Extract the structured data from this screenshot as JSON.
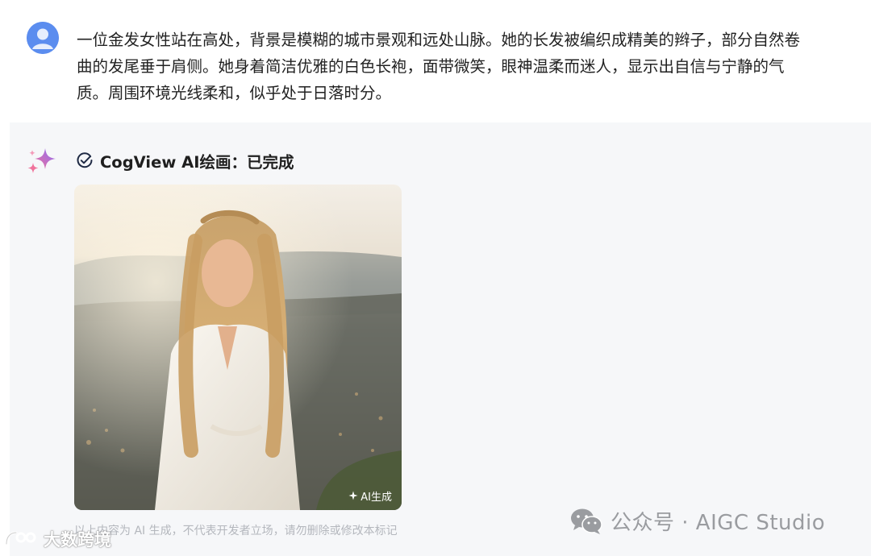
{
  "user_message": {
    "text": "一位金发女性站在高处，背景是模糊的城市景观和远处山脉。她的长发被编织成精美的辫子，部分自然卷曲的发尾垂于肩侧。她身着简洁优雅的白色长袍，面带微笑，眼神温柔而迷人，显示出自信与宁静的气质。周围环境光线柔和，似乎处于日落时分。"
  },
  "ai_response": {
    "status_label": "CogView AI绘画：已完成",
    "image_badge": "AI生成",
    "disclaimer": "以上内容为 AI 生成，不代表开发者立场，请勿删除或修改本标记"
  },
  "watermarks": {
    "wechat_account": "公众号 · AIGC Studio",
    "bottom_left": "大数跨境"
  },
  "colors": {
    "avatar": "#5b8def",
    "panel_bg": "#f6f7f9",
    "sparkle_pink": "#f0739b",
    "sparkle_purple": "#8b6cf6",
    "check": "#1f2a44"
  }
}
